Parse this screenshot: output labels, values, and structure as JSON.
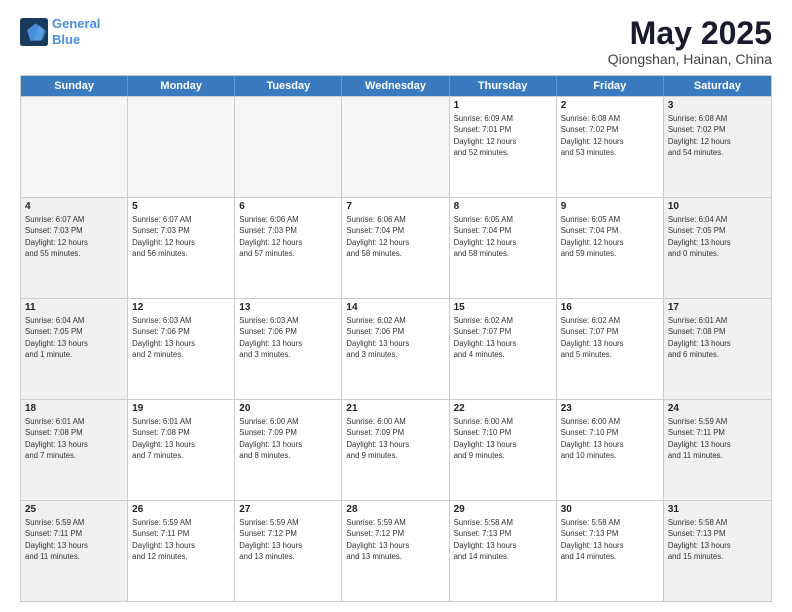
{
  "logo": {
    "line1": "General",
    "line2": "Blue"
  },
  "title": "May 2025",
  "subtitle": "Qiongshan, Hainan, China",
  "days_of_week": [
    "Sunday",
    "Monday",
    "Tuesday",
    "Wednesday",
    "Thursday",
    "Friday",
    "Saturday"
  ],
  "weeks": [
    [
      {
        "num": "",
        "info": "",
        "empty": true
      },
      {
        "num": "",
        "info": "",
        "empty": true
      },
      {
        "num": "",
        "info": "",
        "empty": true
      },
      {
        "num": "",
        "info": "",
        "empty": true
      },
      {
        "num": "1",
        "info": "Sunrise: 6:09 AM\nSunset: 7:01 PM\nDaylight: 12 hours\nand 52 minutes.",
        "empty": false
      },
      {
        "num": "2",
        "info": "Sunrise: 6:08 AM\nSunset: 7:02 PM\nDaylight: 12 hours\nand 53 minutes.",
        "empty": false
      },
      {
        "num": "3",
        "info": "Sunrise: 6:08 AM\nSunset: 7:02 PM\nDaylight: 12 hours\nand 54 minutes.",
        "empty": false
      }
    ],
    [
      {
        "num": "4",
        "info": "Sunrise: 6:07 AM\nSunset: 7:03 PM\nDaylight: 12 hours\nand 55 minutes.",
        "empty": false
      },
      {
        "num": "5",
        "info": "Sunrise: 6:07 AM\nSunset: 7:03 PM\nDaylight: 12 hours\nand 56 minutes.",
        "empty": false
      },
      {
        "num": "6",
        "info": "Sunrise: 6:06 AM\nSunset: 7:03 PM\nDaylight: 12 hours\nand 57 minutes.",
        "empty": false
      },
      {
        "num": "7",
        "info": "Sunrise: 6:06 AM\nSunset: 7:04 PM\nDaylight: 12 hours\nand 58 minutes.",
        "empty": false
      },
      {
        "num": "8",
        "info": "Sunrise: 6:05 AM\nSunset: 7:04 PM\nDaylight: 12 hours\nand 58 minutes.",
        "empty": false
      },
      {
        "num": "9",
        "info": "Sunrise: 6:05 AM\nSunset: 7:04 PM\nDaylight: 12 hours\nand 59 minutes.",
        "empty": false
      },
      {
        "num": "10",
        "info": "Sunrise: 6:04 AM\nSunset: 7:05 PM\nDaylight: 13 hours\nand 0 minutes.",
        "empty": false
      }
    ],
    [
      {
        "num": "11",
        "info": "Sunrise: 6:04 AM\nSunset: 7:05 PM\nDaylight: 13 hours\nand 1 minute.",
        "empty": false
      },
      {
        "num": "12",
        "info": "Sunrise: 6:03 AM\nSunset: 7:06 PM\nDaylight: 13 hours\nand 2 minutes.",
        "empty": false
      },
      {
        "num": "13",
        "info": "Sunrise: 6:03 AM\nSunset: 7:06 PM\nDaylight: 13 hours\nand 3 minutes.",
        "empty": false
      },
      {
        "num": "14",
        "info": "Sunrise: 6:02 AM\nSunset: 7:06 PM\nDaylight: 13 hours\nand 3 minutes.",
        "empty": false
      },
      {
        "num": "15",
        "info": "Sunrise: 6:02 AM\nSunset: 7:07 PM\nDaylight: 13 hours\nand 4 minutes.",
        "empty": false
      },
      {
        "num": "16",
        "info": "Sunrise: 6:02 AM\nSunset: 7:07 PM\nDaylight: 13 hours\nand 5 minutes.",
        "empty": false
      },
      {
        "num": "17",
        "info": "Sunrise: 6:01 AM\nSunset: 7:08 PM\nDaylight: 13 hours\nand 6 minutes.",
        "empty": false
      }
    ],
    [
      {
        "num": "18",
        "info": "Sunrise: 6:01 AM\nSunset: 7:08 PM\nDaylight: 13 hours\nand 7 minutes.",
        "empty": false
      },
      {
        "num": "19",
        "info": "Sunrise: 6:01 AM\nSunset: 7:08 PM\nDaylight: 13 hours\nand 7 minutes.",
        "empty": false
      },
      {
        "num": "20",
        "info": "Sunrise: 6:00 AM\nSunset: 7:09 PM\nDaylight: 13 hours\nand 8 minutes.",
        "empty": false
      },
      {
        "num": "21",
        "info": "Sunrise: 6:00 AM\nSunset: 7:09 PM\nDaylight: 13 hours\nand 9 minutes.",
        "empty": false
      },
      {
        "num": "22",
        "info": "Sunrise: 6:00 AM\nSunset: 7:10 PM\nDaylight: 13 hours\nand 9 minutes.",
        "empty": false
      },
      {
        "num": "23",
        "info": "Sunrise: 6:00 AM\nSunset: 7:10 PM\nDaylight: 13 hours\nand 10 minutes.",
        "empty": false
      },
      {
        "num": "24",
        "info": "Sunrise: 5:59 AM\nSunset: 7:11 PM\nDaylight: 13 hours\nand 11 minutes.",
        "empty": false
      }
    ],
    [
      {
        "num": "25",
        "info": "Sunrise: 5:59 AM\nSunset: 7:11 PM\nDaylight: 13 hours\nand 11 minutes.",
        "empty": false
      },
      {
        "num": "26",
        "info": "Sunrise: 5:59 AM\nSunset: 7:11 PM\nDaylight: 13 hours\nand 12 minutes.",
        "empty": false
      },
      {
        "num": "27",
        "info": "Sunrise: 5:59 AM\nSunset: 7:12 PM\nDaylight: 13 hours\nand 13 minutes.",
        "empty": false
      },
      {
        "num": "28",
        "info": "Sunrise: 5:59 AM\nSunset: 7:12 PM\nDaylight: 13 hours\nand 13 minutes.",
        "empty": false
      },
      {
        "num": "29",
        "info": "Sunrise: 5:58 AM\nSunset: 7:13 PM\nDaylight: 13 hours\nand 14 minutes.",
        "empty": false
      },
      {
        "num": "30",
        "info": "Sunrise: 5:58 AM\nSunset: 7:13 PM\nDaylight: 13 hours\nand 14 minutes.",
        "empty": false
      },
      {
        "num": "31",
        "info": "Sunrise: 5:58 AM\nSunset: 7:13 PM\nDaylight: 13 hours\nand 15 minutes.",
        "empty": false
      }
    ]
  ]
}
